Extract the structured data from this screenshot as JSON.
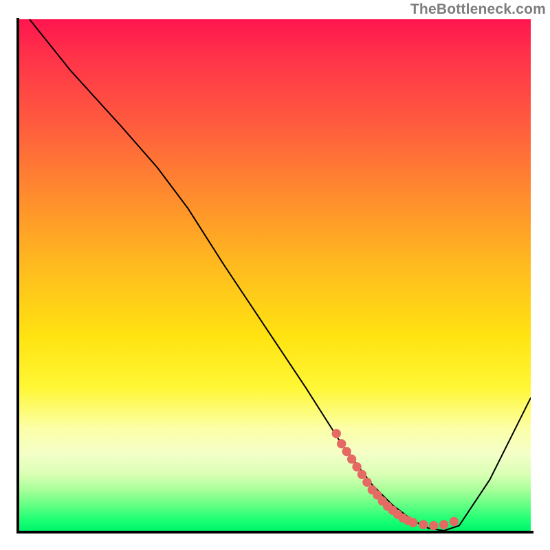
{
  "watermark": "TheBottleneck.com",
  "chart_data": {
    "type": "line",
    "title": "",
    "xlabel": "",
    "ylabel": "",
    "xlim": [
      0,
      100
    ],
    "ylim": [
      0,
      100
    ],
    "grid": false,
    "legend": false,
    "background_gradient": {
      "direction": "vertical",
      "stops": [
        {
          "pos": 0,
          "color": "#ff154f"
        },
        {
          "pos": 20,
          "color": "#ff5a3f"
        },
        {
          "pos": 48,
          "color": "#ffba1f"
        },
        {
          "pos": 72,
          "color": "#fff735"
        },
        {
          "pos": 85,
          "color": "#f4ffc8"
        },
        {
          "pos": 100,
          "color": "#00f56a"
        }
      ]
    },
    "series": [
      {
        "name": "bottleneck-curve",
        "color": "#000000",
        "x": [
          2,
          10,
          20,
          27,
          33,
          40,
          48,
          56,
          63,
          69,
          73,
          77,
          80,
          83,
          86,
          92,
          100
        ],
        "y": [
          100,
          90,
          79,
          71,
          63,
          52,
          40,
          28,
          17,
          9,
          5,
          2,
          0.5,
          0,
          1,
          10,
          26
        ]
      }
    ],
    "markers": {
      "name": "highlight-dots",
      "color": "#e46a63",
      "points": [
        {
          "x": 62,
          "y": 19
        },
        {
          "x": 63,
          "y": 17
        },
        {
          "x": 64,
          "y": 15.5
        },
        {
          "x": 65,
          "y": 14
        },
        {
          "x": 66,
          "y": 12.5
        },
        {
          "x": 67,
          "y": 11
        },
        {
          "x": 68,
          "y": 9.5
        },
        {
          "x": 69,
          "y": 8
        },
        {
          "x": 70,
          "y": 7
        },
        {
          "x": 71,
          "y": 5.8
        },
        {
          "x": 72,
          "y": 4.8
        },
        {
          "x": 73,
          "y": 4
        },
        {
          "x": 74,
          "y": 3.2
        },
        {
          "x": 75,
          "y": 2.5
        },
        {
          "x": 76,
          "y": 2
        },
        {
          "x": 77,
          "y": 1.6
        },
        {
          "x": 79,
          "y": 1.2
        },
        {
          "x": 81,
          "y": 1.0
        },
        {
          "x": 83,
          "y": 1.2
        },
        {
          "x": 85,
          "y": 1.8
        }
      ]
    }
  }
}
